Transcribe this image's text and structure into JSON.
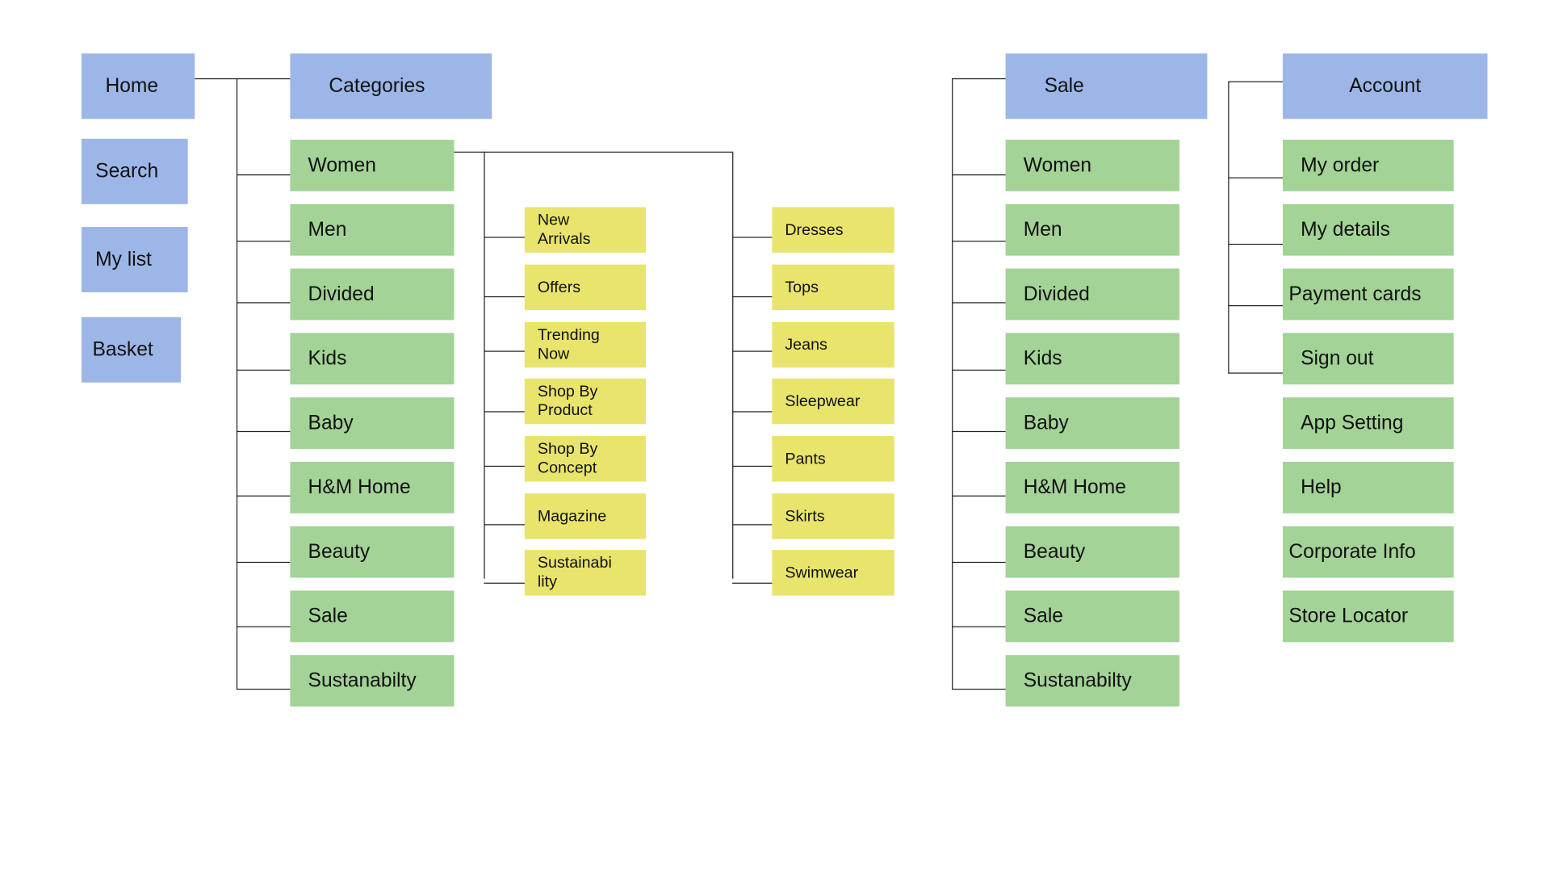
{
  "colors": {
    "nav": "#9db6e8",
    "category": "#a3d397",
    "subcategory": "#e8e46c",
    "connector": "#222222"
  },
  "nav": [
    "Home",
    "Search",
    "My list",
    "Basket"
  ],
  "categories": {
    "title": "Categories",
    "items": [
      "Women",
      "Men",
      "Divided",
      "Kids",
      "Baby",
      "H&M Home",
      "Beauty",
      "Sale",
      "Sustanabilty"
    ]
  },
  "women_sections": [
    "New\nArrivals",
    "Offers",
    "Trending\nNow",
    "Shop By\nProduct",
    "Shop By\nConcept",
    "Magazine",
    "Sustainabi\nlity"
  ],
  "women_products": [
    "Dresses",
    "Tops",
    "Jeans",
    "Sleepwear",
    "Pants",
    "Skirts",
    "Swimwear"
  ],
  "sale": {
    "title": "Sale",
    "items": [
      "Women",
      "Men",
      "Divided",
      "Kids",
      "Baby",
      "H&M Home",
      "Beauty",
      "Sale",
      "Sustanabilty"
    ]
  },
  "account": {
    "title": "Account",
    "items": [
      "My order",
      "My details",
      "Payment cards",
      "Sign out",
      "App Setting",
      "Help",
      "Corporate Info",
      "Store Locator"
    ]
  }
}
